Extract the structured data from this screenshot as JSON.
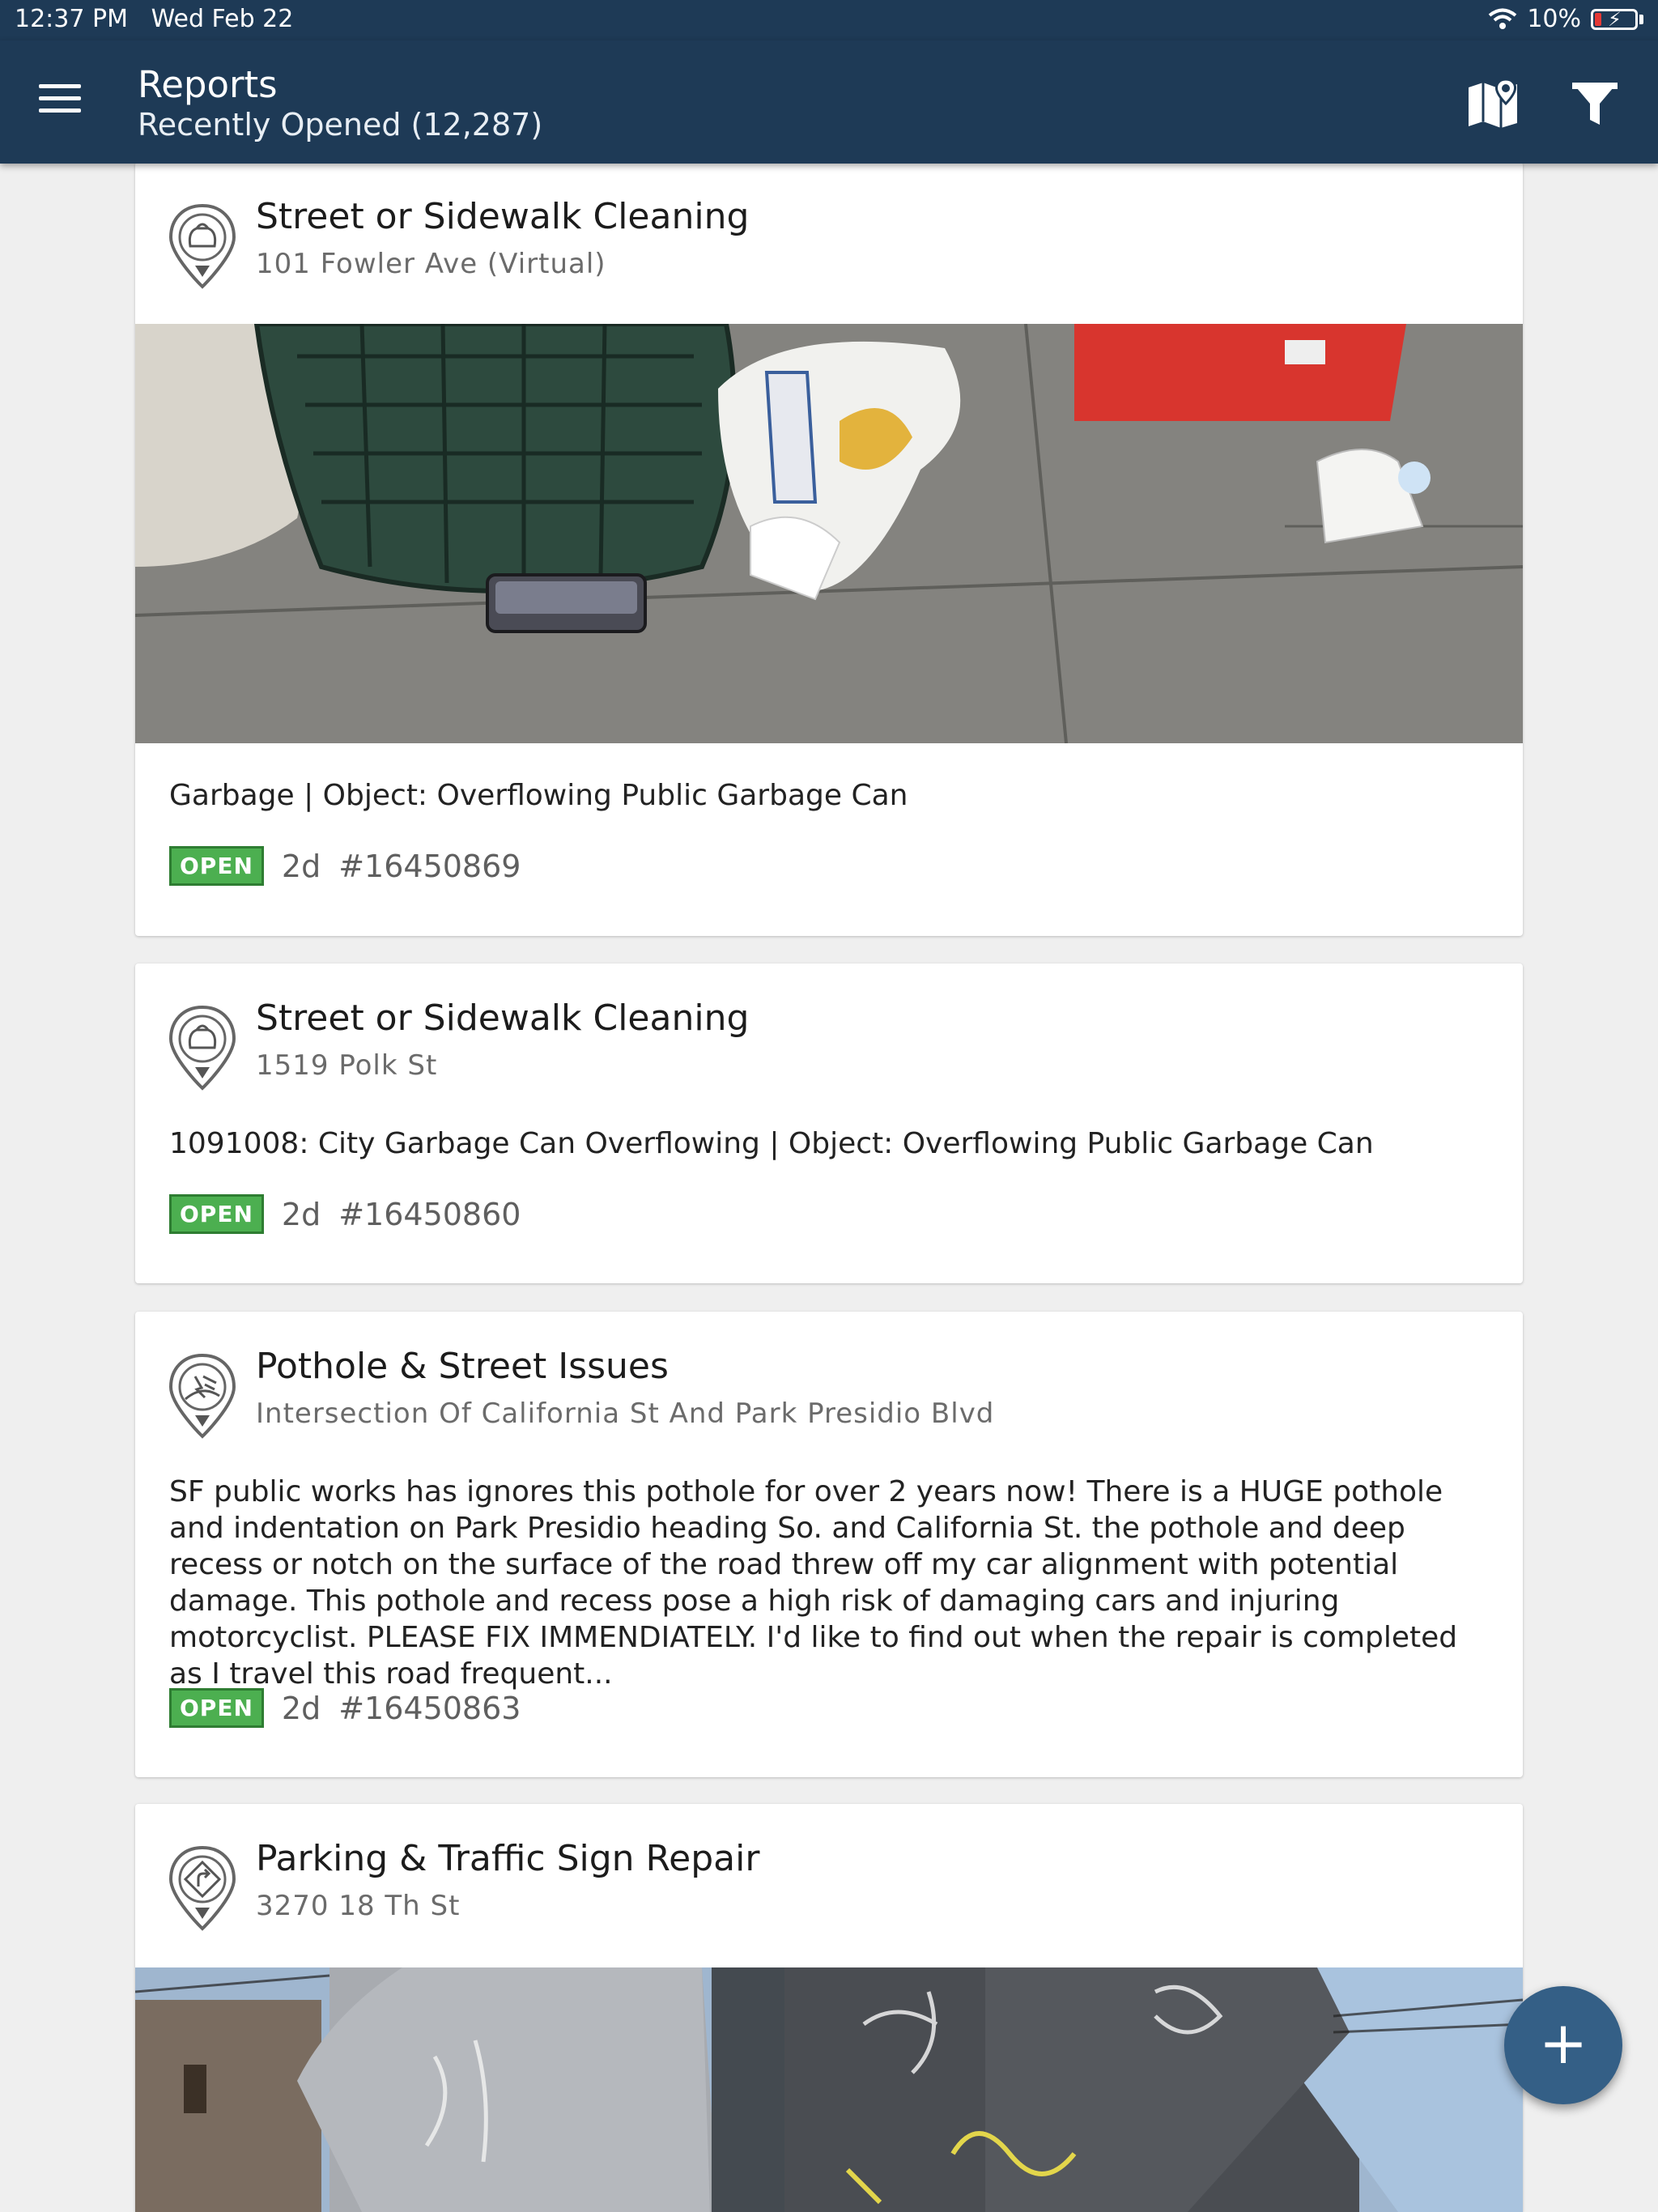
{
  "status_bar": {
    "time": "12:37 PM",
    "date": "Wed Feb 22",
    "battery": "10%",
    "wifi_icon": "wifi-icon"
  },
  "header": {
    "title": "Reports",
    "subtitle": "Recently Opened (12,287)",
    "menu_icon": "hamburger-menu-icon",
    "map_icon": "map-pin-icon",
    "filter_icon": "filter-funnel-icon"
  },
  "colors": {
    "header_bg": "#1e3a56",
    "badge_green": "#4caf50",
    "fab_bg": "#345f86"
  },
  "reports": [
    {
      "category": "Street or Sidewalk Cleaning",
      "address": "101 Fowler Ave (Virtual)",
      "description": "Garbage | Object: Overflowing Public Garbage Can",
      "status": "OPEN",
      "age": "2d",
      "id": "#16450869",
      "icon": "trash-bag-pin-icon",
      "has_photo": true
    },
    {
      "category": "Street or Sidewalk Cleaning",
      "address": "1519 Polk St",
      "description": "1091008: City Garbage Can Overflowing | Object: Overflowing Public Garbage Can",
      "status": "OPEN",
      "age": "2d",
      "id": "#16450860",
      "icon": "trash-bag-pin-icon",
      "has_photo": false
    },
    {
      "category": "Pothole & Street Issues",
      "address": "Intersection Of California St And Park Presidio Blvd",
      "description": "SF public works has ignores this pothole for over 2 years now!  There is a HUGE pothole and indentation on Park Presidio heading So. and California St.  the pothole and  deep recess or notch on the surface of the road threw off my car alignment with potential damage.    This pothole and recess pose a high risk of damaging cars and injuring motorcyclist.  PLEASE FIX IMMENDIATELY.  I'd like to find out when the repair is completed as I travel this road frequent...",
      "status": "OPEN",
      "age": "2d",
      "id": "#16450863",
      "icon": "pothole-pin-icon",
      "has_photo": false
    },
    {
      "category": "Parking & Traffic Sign Repair",
      "address": "3270 18 Th St",
      "icon": "traffic-sign-pin-icon",
      "has_photo": true
    }
  ],
  "fab": {
    "label": "+",
    "icon": "plus-icon"
  }
}
